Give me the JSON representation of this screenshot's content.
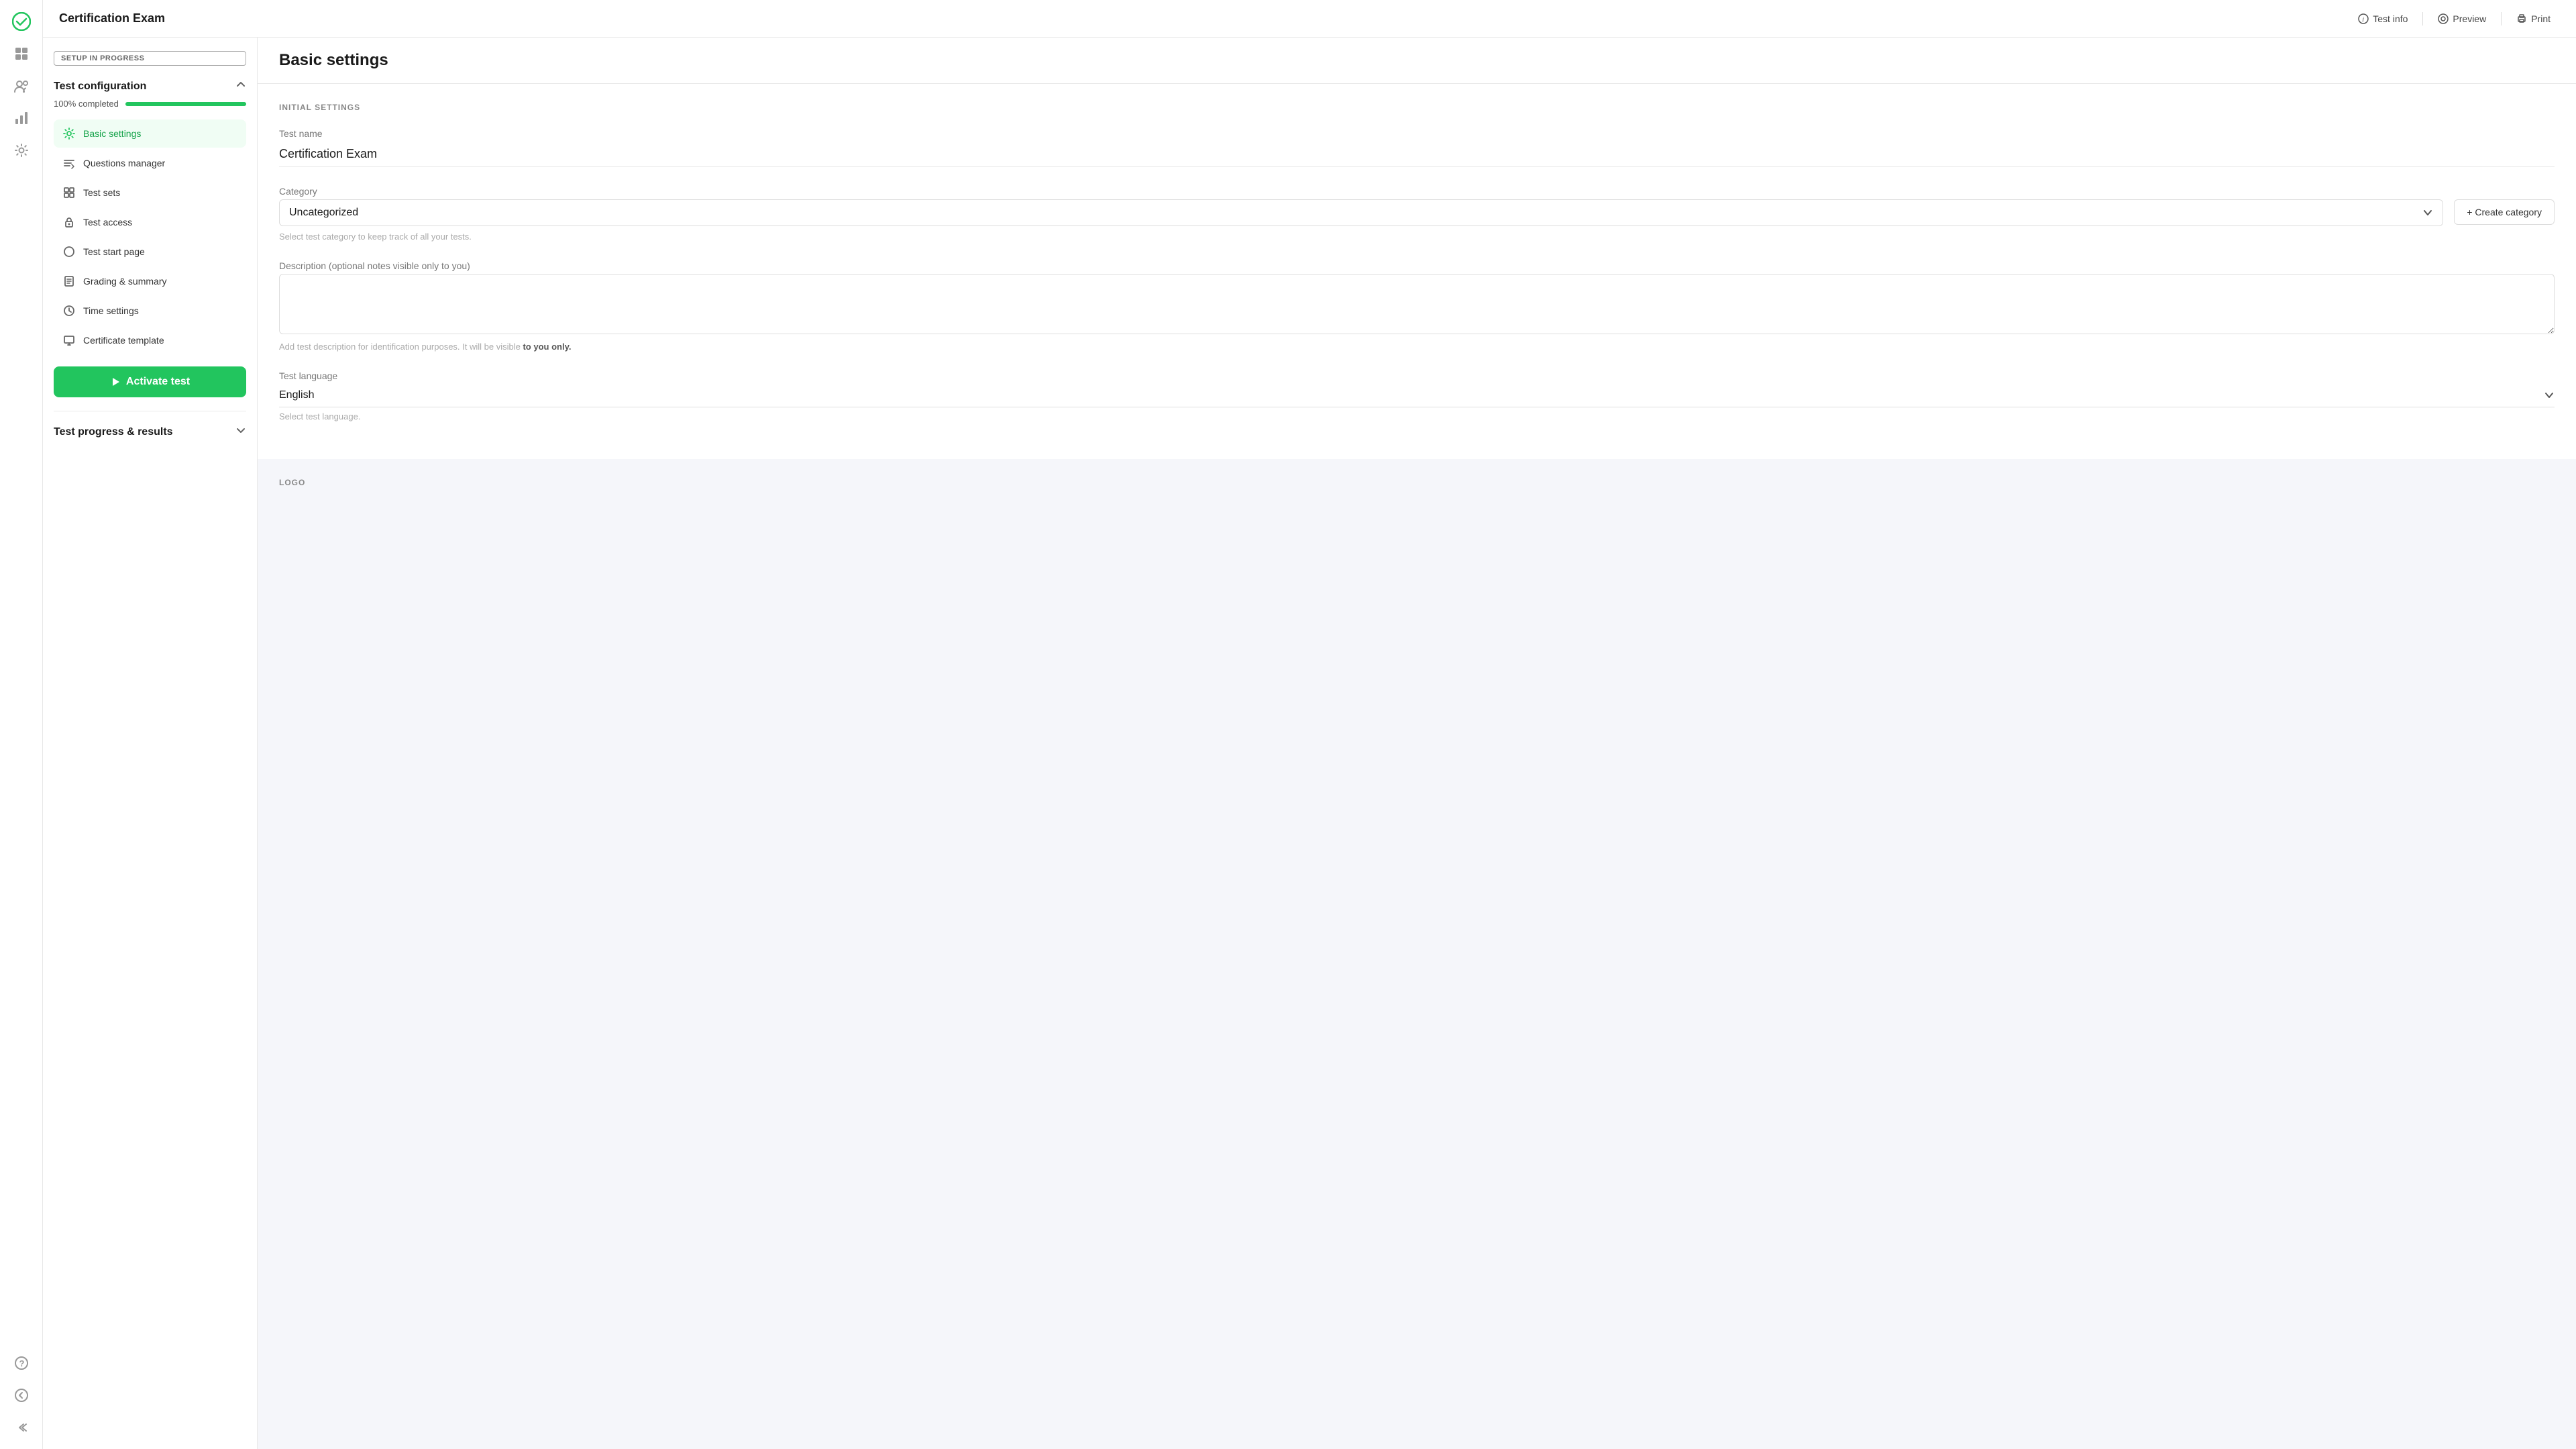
{
  "brand": {
    "icon": "✓",
    "title": "Certification Exam"
  },
  "header": {
    "title": "Certification Exam",
    "actions": [
      {
        "id": "test-info",
        "icon": "ℹ",
        "label": "Test info"
      },
      {
        "id": "preview",
        "icon": "👁",
        "label": "Preview"
      },
      {
        "id": "print",
        "icon": "🖨",
        "label": "Print"
      }
    ]
  },
  "rail_icons": [
    {
      "id": "brand",
      "icon": "✓",
      "class": "brand"
    },
    {
      "id": "grid",
      "icon": "⊞"
    },
    {
      "id": "users",
      "icon": "👥"
    },
    {
      "id": "chart",
      "icon": "📊"
    },
    {
      "id": "settings",
      "icon": "⚙"
    }
  ],
  "rail_bottom_icons": [
    {
      "id": "help",
      "icon": "?"
    },
    {
      "id": "back",
      "icon": "←"
    },
    {
      "id": "collapse",
      "icon": "»"
    }
  ],
  "sidebar": {
    "setup_badge": "SETUP IN PROGRESS",
    "section1": {
      "title": "Test configuration",
      "progress_label": "100% completed",
      "progress_value": 100,
      "nav_items": [
        {
          "id": "basic-settings",
          "icon": "⚙",
          "label": "Basic settings",
          "active": true
        },
        {
          "id": "questions-manager",
          "icon": "≡",
          "label": "Questions manager",
          "active": false
        },
        {
          "id": "test-sets",
          "icon": "⊞",
          "label": "Test sets",
          "active": false
        },
        {
          "id": "test-access",
          "icon": "🔒",
          "label": "Test access",
          "active": false
        },
        {
          "id": "test-start-page",
          "icon": "○",
          "label": "Test start page",
          "active": false
        },
        {
          "id": "grading-summary",
          "icon": "📋",
          "label": "Grading & summary",
          "active": false
        },
        {
          "id": "time-settings",
          "icon": "⏱",
          "label": "Time settings",
          "active": false
        },
        {
          "id": "certificate-template",
          "icon": "📜",
          "label": "Certificate template",
          "active": false
        }
      ],
      "activate_btn": "Activate test"
    },
    "section2": {
      "title": "Test progress & results"
    }
  },
  "main": {
    "page_title": "Basic settings",
    "initial_settings_label": "INITIAL SETTINGS",
    "test_name_label": "Test name",
    "test_name_value": "Certification Exam",
    "category_label": "Category",
    "category_value": "Uncategorized",
    "category_hint": "Select test category to keep track of all your tests.",
    "create_category_label": "+ Create category",
    "description_label": "Description (optional notes visible only to you)",
    "description_hint_1": "Add test description for identification purposes. It will be visible ",
    "description_hint_bold": "to you only.",
    "language_label": "Test language",
    "language_value": "English",
    "language_hint": "Select test language.",
    "logo_label": "LOGO"
  },
  "colors": {
    "green": "#22c55e",
    "green_dark": "#16a34a",
    "text_primary": "#1a1a1a",
    "text_secondary": "#777",
    "border": "#e8e8e8"
  }
}
